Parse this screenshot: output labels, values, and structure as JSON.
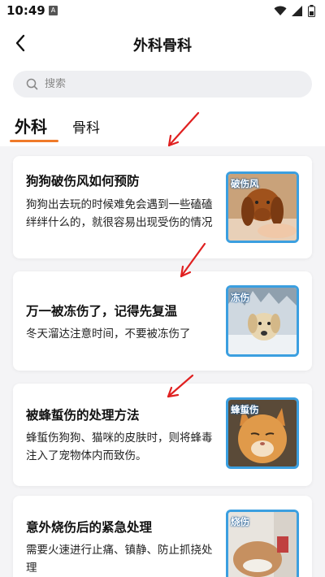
{
  "status_bar": {
    "time": "10:49",
    "indicator": "A"
  },
  "header": {
    "title": "外科骨科",
    "back_icon": "chevron-left-icon"
  },
  "search": {
    "placeholder": "搜索"
  },
  "tabs": [
    {
      "label": "外科",
      "active": true
    },
    {
      "label": "骨科",
      "active": false
    }
  ],
  "colors": {
    "accent": "#f07a2a",
    "thumb_border": "#3b9fe0",
    "annotation_arrow": "#e02020"
  },
  "articles": [
    {
      "title": "狗狗破伤风如何预防",
      "desc": "狗狗出去玩的时候难免会遇到一些磕磕绊绊什么的，就很容易出现受伤的情况",
      "tag": "破伤风"
    },
    {
      "title": "万一被冻伤了，记得先复温",
      "desc": "冬天溜达注意时间，不要被冻伤了",
      "tag": "冻伤"
    },
    {
      "title": "被蜂蜇伤的处理方法",
      "desc": "蜂蜇伤狗狗、猫咪的皮肤时，则将蜂毒注入了宠物体内而致伤。",
      "tag": "蜂蜇伤"
    },
    {
      "title": "意外烧伤后的紧急处理",
      "desc": "需要火速进行止痛、镇静、防止抓挠处理",
      "tag": "烧伤"
    }
  ]
}
